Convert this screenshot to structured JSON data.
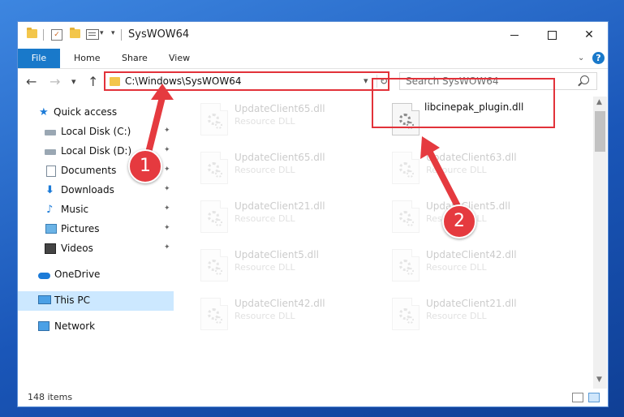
{
  "window": {
    "title": "SysWOW64",
    "qat_divider": "|",
    "customize_arrow": "▾",
    "customize_arrow2": "▾",
    "minimize_label": "",
    "close_label": "✕"
  },
  "ribbon": {
    "tabs": [
      "File",
      "Home",
      "Share",
      "View"
    ],
    "expand_icon": "chevron-down-icon",
    "help_label": "?"
  },
  "nav": {
    "back": "←",
    "forward": "→",
    "recent": "▾",
    "up": "↑"
  },
  "address": {
    "path": "C:\\Windows\\SysWOW64",
    "dropdown": "▾",
    "refresh": "↻"
  },
  "search": {
    "placeholder": "Search SysWOW64"
  },
  "sidebar": {
    "items": [
      {
        "label": "Quick access",
        "icon": "star-icon"
      },
      {
        "label": "Local Disk (C:)",
        "icon": "drive-icon",
        "pinned": true
      },
      {
        "label": "Local Disk (D:)",
        "icon": "drive-icon",
        "pinned": true
      },
      {
        "label": "Documents",
        "icon": "documents-icon",
        "pinned": true
      },
      {
        "label": "Downloads",
        "icon": "download-icon",
        "pinned": true
      },
      {
        "label": "Music",
        "icon": "music-icon",
        "pinned": true
      },
      {
        "label": "Pictures",
        "icon": "pictures-icon",
        "pinned": true
      },
      {
        "label": "Videos",
        "icon": "videos-icon",
        "pinned": true
      },
      {
        "label": "OneDrive",
        "icon": "cloud-icon"
      },
      {
        "label": "This PC",
        "icon": "computer-icon",
        "selected": true
      },
      {
        "label": "Network",
        "icon": "network-icon"
      }
    ],
    "pin_glyph": "📌"
  },
  "files": {
    "left": [
      {
        "name": "UpdateClient65.dll",
        "type": "Resource DLL"
      },
      {
        "name": "UpdateClient65.dll",
        "type": "Resource DLL"
      },
      {
        "name": "UpdateClient21.dll",
        "type": "Resource DLL"
      },
      {
        "name": "UpdateClient5.dll",
        "type": "Resource DLL"
      },
      {
        "name": "UpdateClient42.dll",
        "type": "Resource DLL"
      }
    ],
    "right": [
      {
        "name": "libcinepak_plugin.dll",
        "type": "",
        "highlighted": true
      },
      {
        "name": "UpdateClient63.dll",
        "type": "Resource DLL"
      },
      {
        "name": "UpdateClient5.dll",
        "type": "Resource DLL"
      },
      {
        "name": "UpdateClient42.dll",
        "type": "Resource DLL"
      },
      {
        "name": "UpdateClient21.dll",
        "type": "Resource DLL"
      }
    ]
  },
  "status": {
    "count": "148 items"
  },
  "annotations": {
    "step1": "1",
    "step2": "2",
    "color": "#e53a3f"
  }
}
